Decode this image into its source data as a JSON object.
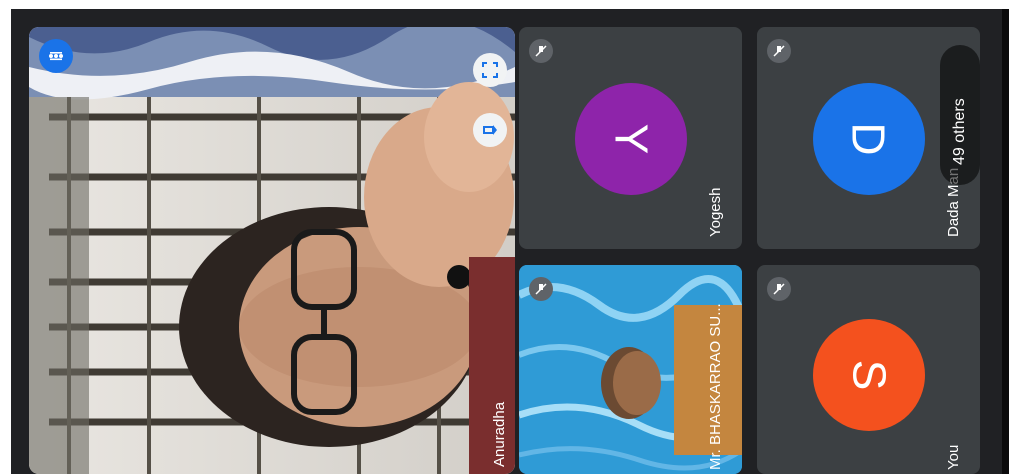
{
  "tiles": {
    "main": {
      "name": "Anuradha"
    },
    "bhaskar": {
      "name": "Mr. BHASKARRAO SU..."
    },
    "yogesh": {
      "name": "Yogesh",
      "initial": "Y",
      "color": "#8e24aa"
    },
    "you": {
      "name": "You",
      "initial": "S",
      "color": "#f4511e"
    },
    "dada": {
      "name": "Dada Man",
      "initial": "D",
      "color": "#1a73e8"
    }
  },
  "others": {
    "label": "49 others"
  },
  "icons": {
    "menu": "more-options-icon",
    "fullscreen": "fullscreen-icon",
    "pin": "pin-icon",
    "mic_off": "mic-off-icon"
  }
}
